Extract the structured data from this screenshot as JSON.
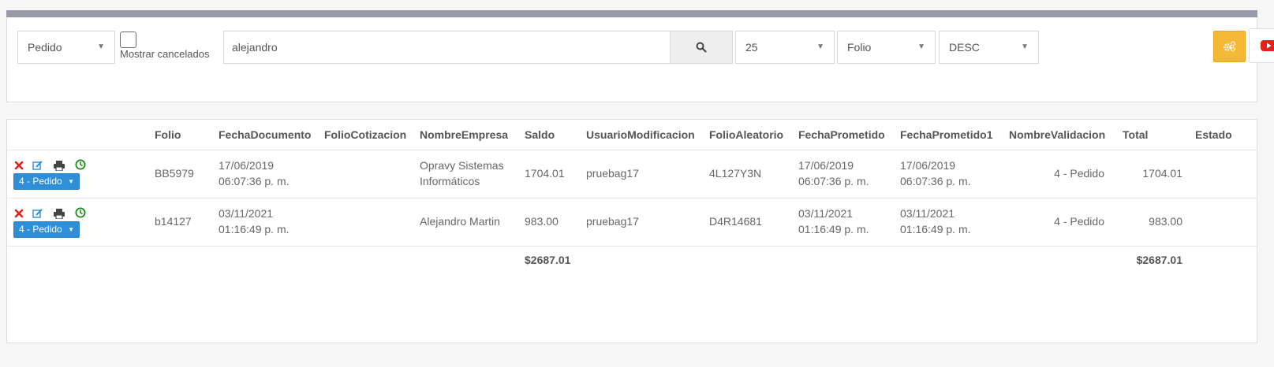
{
  "filters": {
    "type_select": "Pedido",
    "show_cancelled_label": "Mostrar cancelados",
    "search_value": "alejandro",
    "page_size_select": "25",
    "sort_field_select": "Folio",
    "sort_dir_select": "DESC"
  },
  "colors": {
    "topbar": "#999aa7",
    "accent_orange": "#f5b736",
    "status_blue": "#2e8fd8",
    "delete_red": "#e02020",
    "edit_blue": "#2e8fd8",
    "history_green": "#1a8c1a",
    "youtube_red": "#e62117"
  },
  "table": {
    "headers": [
      "Folio",
      "FechaDocumento",
      "FolioCotizacion",
      "NombreEmpresa",
      "Saldo",
      "UsuarioModificacion",
      "FolioAleatorio",
      "FechaPrometido",
      "FechaPrometido1",
      "NombreValidacion",
      "Total",
      "Estado"
    ],
    "rows": [
      {
        "status": "4 - Pedido",
        "folio": "BB5979",
        "fecha_documento": [
          "17/06/2019",
          "06:07:36 p. m."
        ],
        "folio_cotizacion": "",
        "nombre_empresa": [
          "Opravy Sistemas",
          "Informáticos"
        ],
        "saldo": "1704.01",
        "usuario_modificacion": "pruebag17",
        "folio_aleatorio": "4L127Y3N",
        "fecha_prometido": [
          "17/06/2019",
          "06:07:36 p. m."
        ],
        "fecha_prometido1": [
          "17/06/2019",
          "06:07:36 p. m."
        ],
        "nombre_validacion": "4 - Pedido",
        "total": "1704.01",
        "estado": ""
      },
      {
        "status": "4 - Pedido",
        "folio": "b14127",
        "fecha_documento": [
          "03/11/2021",
          "01:16:49 p. m."
        ],
        "folio_cotizacion": "",
        "nombre_empresa": [
          "Alejandro Martin"
        ],
        "saldo": "983.00",
        "usuario_modificacion": "pruebag17",
        "folio_aleatorio": "D4R14681",
        "fecha_prometido": [
          "03/11/2021",
          "01:16:49 p. m."
        ],
        "fecha_prometido1": [
          "03/11/2021",
          "01:16:49 p. m."
        ],
        "nombre_validacion": "4 - Pedido",
        "total": "983.00",
        "estado": ""
      }
    ],
    "totals": {
      "saldo": "$2687.01",
      "total": "$2687.01"
    }
  }
}
